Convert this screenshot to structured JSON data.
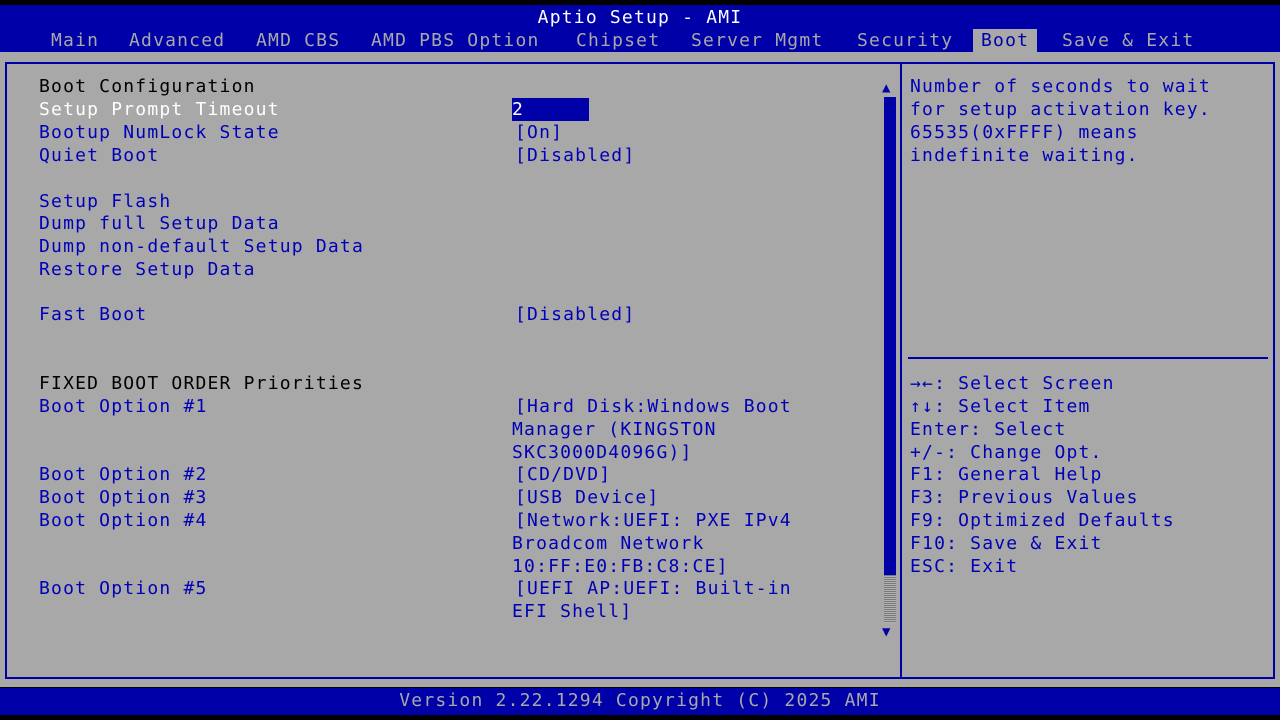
{
  "window": {
    "title": "Aptio Setup - AMI"
  },
  "tabs": [
    {
      "label": "Main",
      "active": false
    },
    {
      "label": "Advanced",
      "active": false
    },
    {
      "label": "AMD CBS",
      "active": false
    },
    {
      "label": "AMD PBS Option",
      "active": false
    },
    {
      "label": "Chipset",
      "active": false
    },
    {
      "label": "Server Mgmt",
      "active": false
    },
    {
      "label": "Security",
      "active": false
    },
    {
      "label": "Boot",
      "active": true
    },
    {
      "label": "Save & Exit",
      "active": false
    }
  ],
  "settings": {
    "boot_config_header": "Boot Configuration",
    "setup_prompt_timeout": {
      "label": "Setup Prompt Timeout",
      "value": "2"
    },
    "bootup_numlock": {
      "label": "Bootup NumLock State",
      "value": "[On]"
    },
    "quiet_boot": {
      "label": "Quiet Boot",
      "value": "[Disabled]"
    },
    "setup_flash": "Setup Flash",
    "dump_full": "Dump full Setup Data",
    "dump_non_default": "Dump non-default Setup Data",
    "restore_setup": "Restore Setup Data",
    "fast_boot": {
      "label": "Fast Boot",
      "value": "[Disabled]"
    },
    "fixed_order_header": "FIXED BOOT ORDER Priorities",
    "boot_options": [
      {
        "label": "Boot Option #1",
        "value_lines": [
          "[Hard Disk:Windows Boot",
          "Manager (KINGSTON",
          "SKC3000D4096G)]"
        ]
      },
      {
        "label": "Boot Option #2",
        "value_lines": [
          "[CD/DVD]"
        ]
      },
      {
        "label": "Boot Option #3",
        "value_lines": [
          "[USB Device]"
        ]
      },
      {
        "label": "Boot Option #4",
        "value_lines": [
          "[Network:UEFI: PXE IPv4",
          "Broadcom Network",
          "10:FF:E0:FB:C8:CE]"
        ]
      },
      {
        "label": "Boot Option #5",
        "value_lines": [
          "[UEFI AP:UEFI: Built-in",
          "EFI Shell]"
        ]
      }
    ]
  },
  "help": {
    "lines": [
      "Number of seconds to wait",
      "for setup activation key.",
      "65535(0xFFFF) means",
      "indefinite waiting."
    ]
  },
  "keys": [
    "→←: Select Screen",
    "↑↓: Select Item",
    "Enter: Select",
    "+/-: Change Opt.",
    "F1: General Help",
    "F3: Previous Values",
    "F9: Optimized Defaults",
    "F10: Save & Exit",
    "ESC: Exit"
  ],
  "footer": {
    "text": "Version 2.22.1294 Copyright (C) 2025 AMI"
  },
  "colors": {
    "bios_blue": "#0000a8",
    "bios_gray": "#a8a8a8",
    "text_blue": "#0000b8"
  }
}
